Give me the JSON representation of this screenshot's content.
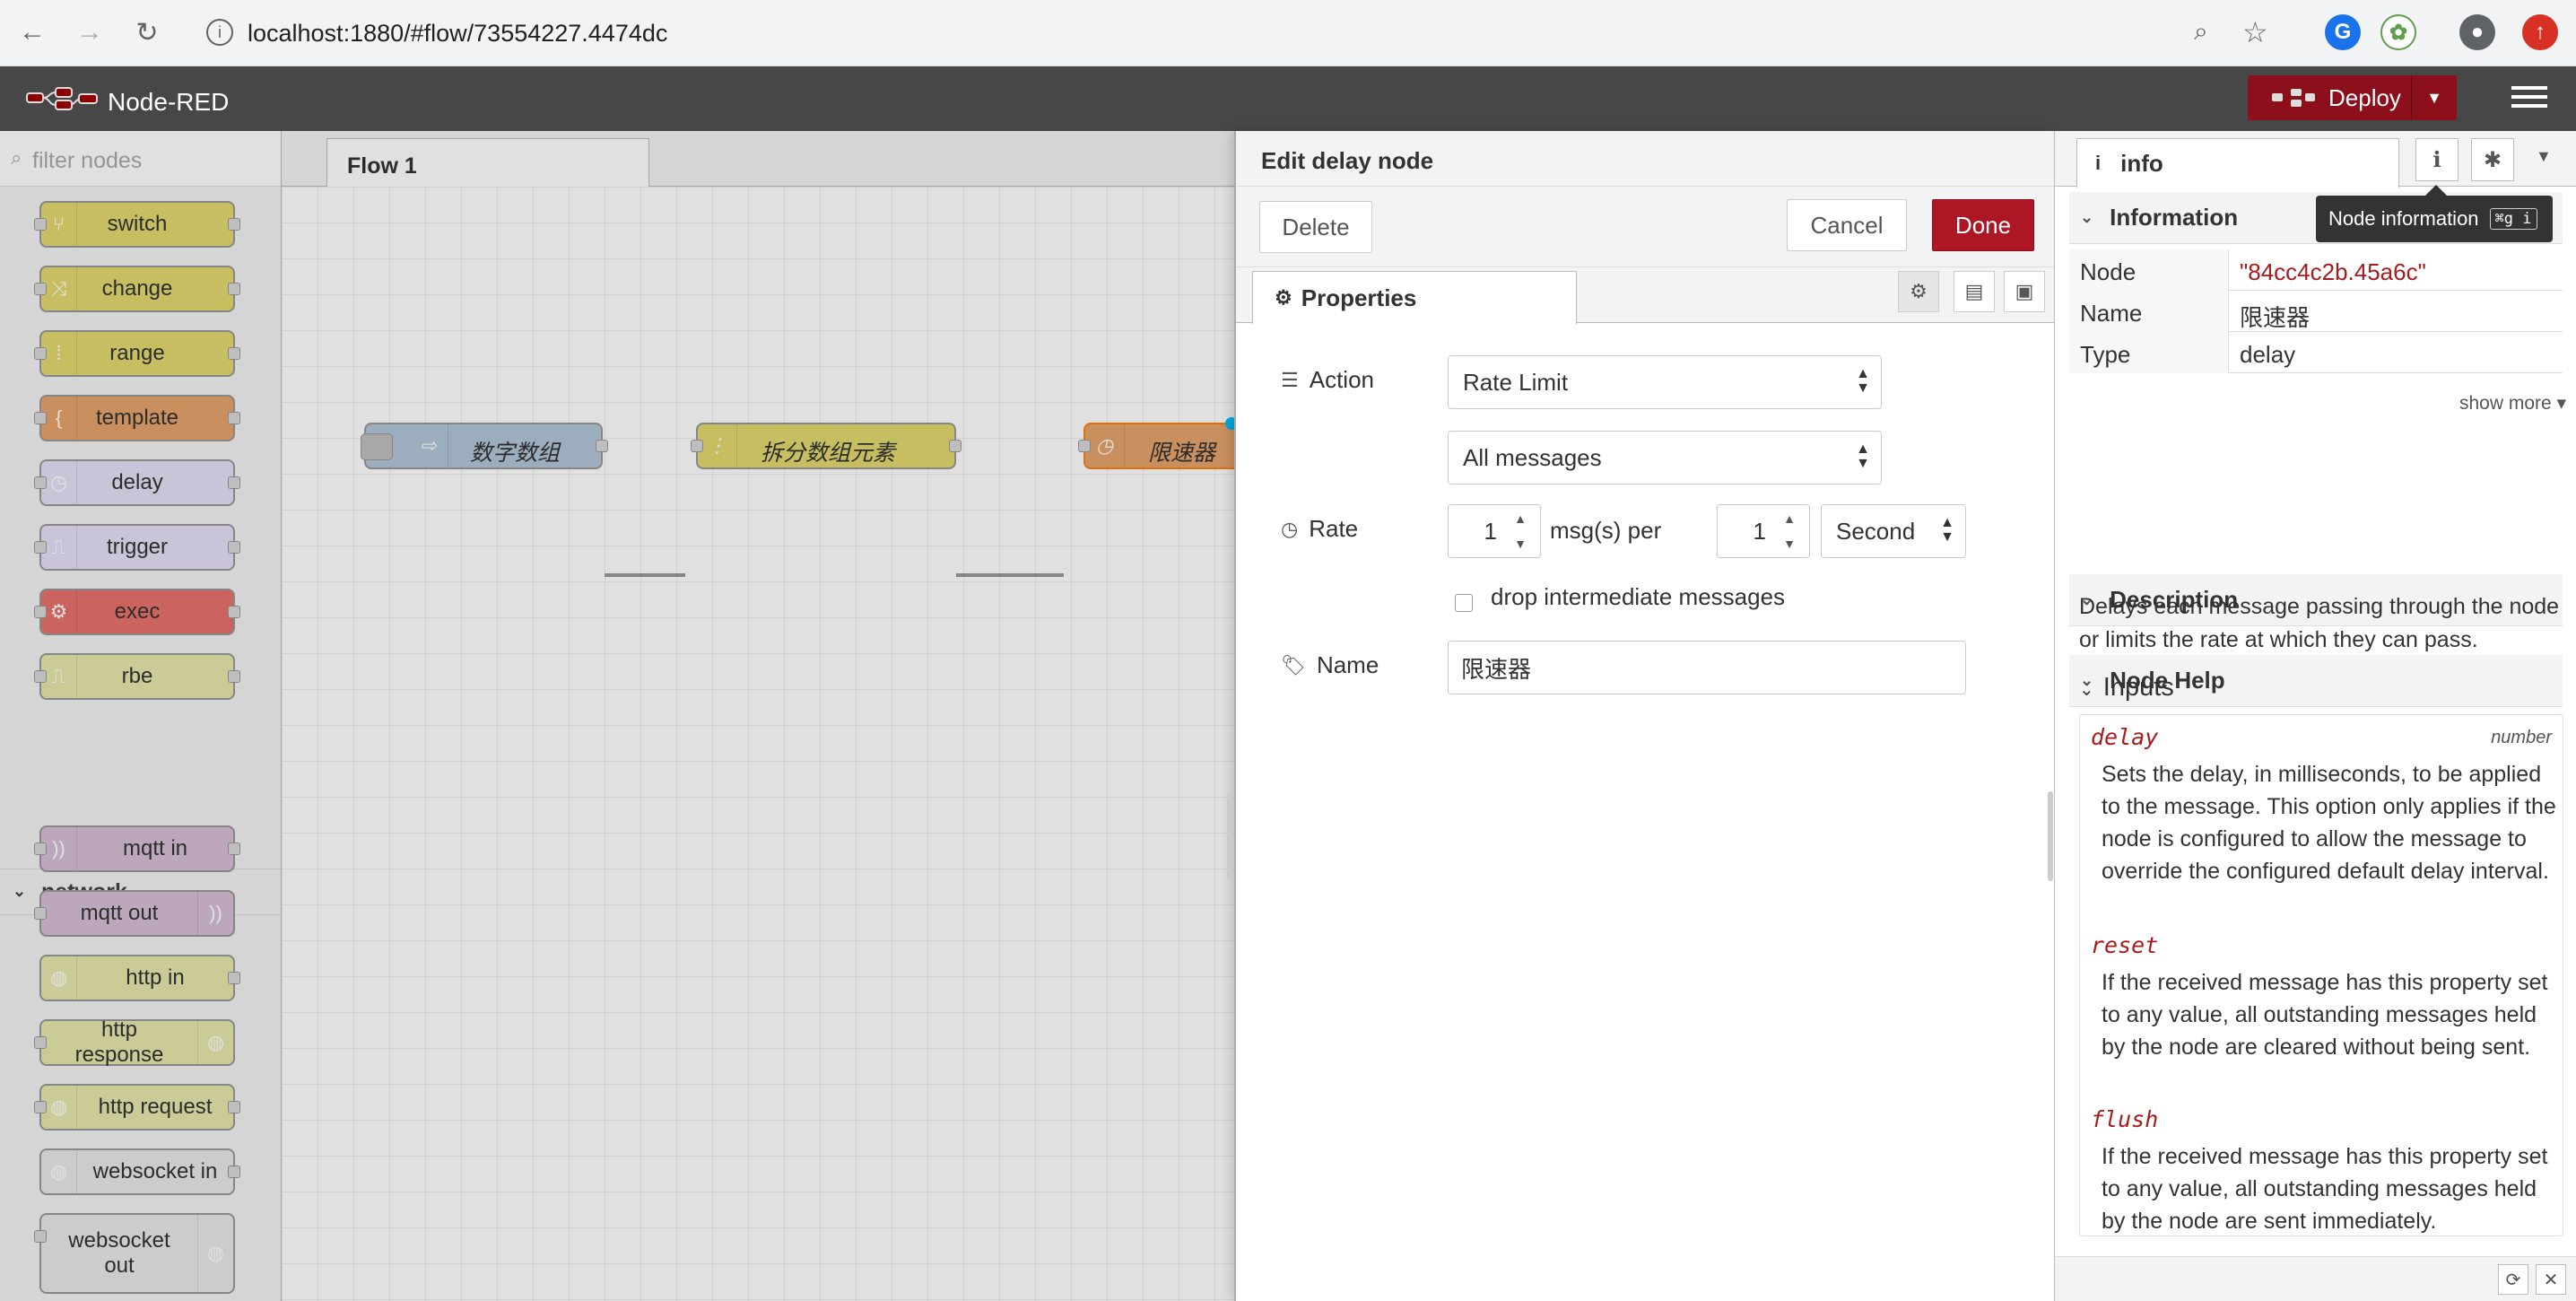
{
  "browser": {
    "url": "localhost:1880/#flow/73554227.4474dc",
    "back_icon": "arrow-left-icon",
    "forward_icon": "arrow-right-icon",
    "reload_icon": "reload-icon"
  },
  "app": {
    "title": "Node-RED",
    "deploy_label": "Deploy"
  },
  "palette": {
    "filter_placeholder": "filter nodes",
    "function_nodes": [
      "switch",
      "change",
      "range",
      "template",
      "delay",
      "trigger",
      "exec",
      "rbe"
    ],
    "network_category": "network",
    "network_nodes": [
      "mqtt in",
      "mqtt out",
      "http in",
      "http response",
      "http request",
      "websocket in",
      "websocket out"
    ]
  },
  "workspace": {
    "tab_label": "Flow 1",
    "nodes": [
      "数字数组",
      "拆分数组元素",
      "限速器"
    ]
  },
  "editor": {
    "title": "Edit delay node",
    "delete_label": "Delete",
    "cancel_label": "Cancel",
    "done_label": "Done",
    "properties_tab": "Properties",
    "action_label": "Action",
    "action_value": "Rate Limit",
    "scope_value": "All messages",
    "rate_label": "Rate",
    "rate_value": "1",
    "msgs_per_label": "msg(s) per",
    "per_value": "1",
    "unit_value": "Second",
    "drop_label": "drop intermediate messages",
    "name_label": "Name",
    "name_value": "限速器"
  },
  "sidebar": {
    "info_tab": "info",
    "tooltip": "Node information",
    "tooltip_shortcut": "⌘g i",
    "information_head": "Information",
    "rows": [
      {
        "k": "Node",
        "v": "\"84cc4c2b.45a6c\""
      },
      {
        "k": "Name",
        "v": "限速器"
      },
      {
        "k": "Type",
        "v": "delay"
      }
    ],
    "show_more": "show more",
    "description_head": "Description",
    "node_help_head": "Node Help",
    "help_text": "Delays each message passing through the node or limits the rate at which they can pass.",
    "inputs_head": "Inputs",
    "props": [
      {
        "name": "delay",
        "type": "number",
        "desc": "Sets the delay, in milliseconds, to be applied to the message. This option only applies if the node is configured to allow the message to override the configured default delay interval."
      },
      {
        "name": "reset",
        "type": "",
        "desc": "If the received message has this property set to any value, all outstanding messages held by the node are cleared without being sent."
      },
      {
        "name": "flush",
        "type": "",
        "desc": "If the received message has this property set to any value, all outstanding messages held by the node are sent immediately."
      }
    ]
  },
  "colors": {
    "header": "#474747",
    "deploy": "#8c101c",
    "done": "#ad1625",
    "prop_name": "#a61c1c"
  }
}
